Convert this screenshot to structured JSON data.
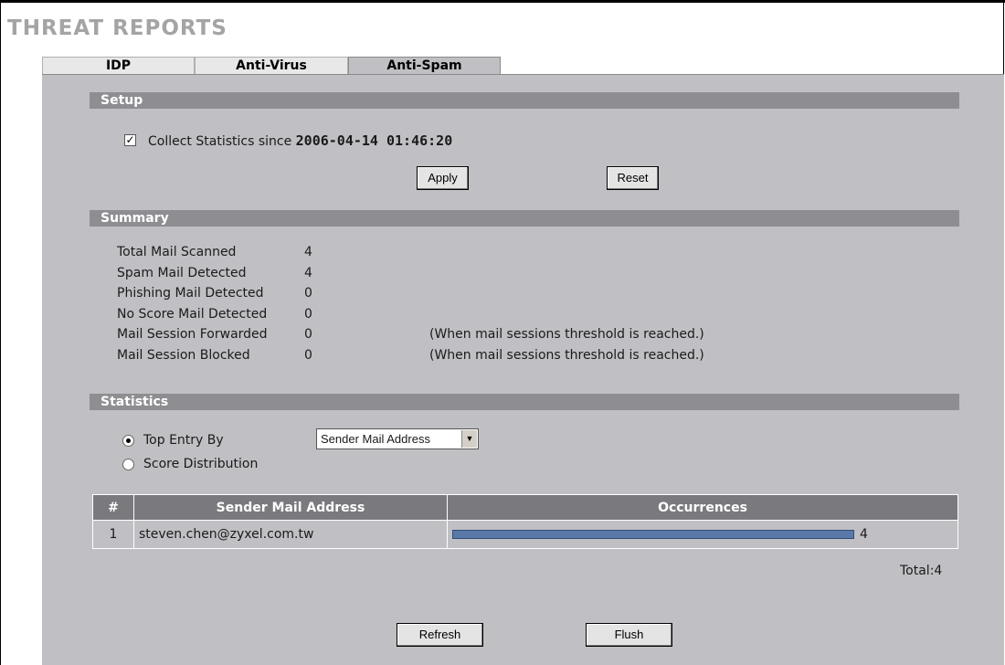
{
  "page_title": "THREAT REPORTS",
  "tabs": [
    {
      "label": "IDP"
    },
    {
      "label": "Anti-Virus"
    },
    {
      "label": "Anti-Spam"
    }
  ],
  "setup": {
    "title": "Setup",
    "collect_label": "Collect Statistics since",
    "collect_since": "2006-04-14 01:46:20",
    "collect_checked": true,
    "apply_label": "Apply",
    "reset_label": "Reset"
  },
  "summary": {
    "title": "Summary",
    "rows": [
      {
        "label": "Total Mail Scanned",
        "value": "4",
        "note": ""
      },
      {
        "label": "Spam Mail Detected",
        "value": "4",
        "note": ""
      },
      {
        "label": "Phishing Mail Detected",
        "value": "0",
        "note": ""
      },
      {
        "label": "No Score Mail Detected",
        "value": "0",
        "note": ""
      },
      {
        "label": "Mail Session Forwarded",
        "value": "0",
        "note": "(When mail sessions threshold is reached.)"
      },
      {
        "label": "Mail Session Blocked",
        "value": "0",
        "note": "(When mail sessions threshold is reached.)"
      }
    ]
  },
  "statistics": {
    "title": "Statistics",
    "radio_top_entry": "Top Entry By",
    "radio_score_distribution": "Score Distribution",
    "select_value": "Sender Mail Address",
    "table": {
      "headers": [
        "#",
        "Sender Mail Address",
        "Occurrences"
      ],
      "rows": [
        {
          "index": "1",
          "address": "steven.chen@zyxel.com.tw",
          "occurrences": "4",
          "bar_fraction": 1.0
        }
      ]
    },
    "total_label": "Total:4",
    "refresh_label": "Refresh",
    "flush_label": "Flush"
  },
  "colors": {
    "section_bar": "#8e8e92",
    "panel": "#c0c0c4",
    "occurrence_bar": "#5a79a8"
  }
}
